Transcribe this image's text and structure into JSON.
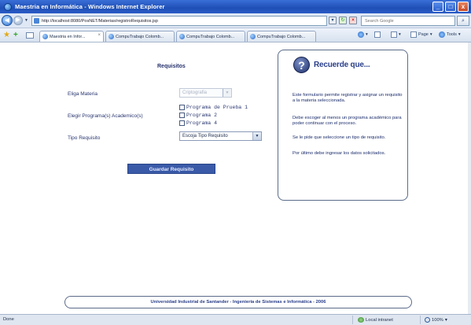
{
  "window": {
    "title": "Maestria en Informática - Windows Internet Explorer",
    "controls": [
      "_",
      "□",
      "x"
    ]
  },
  "addressbar": {
    "url": "http://localhost:8080/PosNET/Materias/registroRequisitos.jsp",
    "search_placeholder": "Search Google"
  },
  "tabs": [
    {
      "label": "Maestria en Infor...",
      "active": true
    },
    {
      "label": "CompuTrabajo Colomb...",
      "active": false
    },
    {
      "label": "CompuTrabajo Colomb...",
      "active": false
    },
    {
      "label": "CompuTrabajo Colomb...",
      "active": false
    }
  ],
  "commandbar": {
    "page_label": "Page",
    "tools_label": "Tools"
  },
  "form": {
    "heading": "Requisitos",
    "materia_label": "Eliga Materia",
    "materia_value": "Criptografia",
    "programas_label": "Elegir Programa(s) Academico(s)",
    "programas": [
      "Programa de Prueba 1",
      "Programa 2",
      "Programa 4"
    ],
    "tipo_label": "Tipo Requisito",
    "tipo_value": "Escoja Tipo Requisito",
    "save_label": "Guardar Requisito"
  },
  "info": {
    "title": "Recuerde que...",
    "paragraphs": [
      "Este formulario permite registrar y asignar un requisito a la materia seleccionada.",
      "Debe escoger al menos un programa académico para poder continuar con el proceso.",
      "Se le pide que seleccione un tipo de requisito.",
      "Por último debe ingresar los datos solicitados."
    ]
  },
  "footer": {
    "text": "Universidad Industrial de Santander - Ingeniería de Sistemas e Informática - 2006"
  },
  "status": {
    "left": "Done",
    "zone": "Local intranet",
    "zoom": "100%"
  },
  "colors": {
    "titlebar": "#1f4fb5",
    "button": "#3a5aa8",
    "panel_border": "#5b6b8a",
    "text_blue": "#2a3f8a"
  }
}
